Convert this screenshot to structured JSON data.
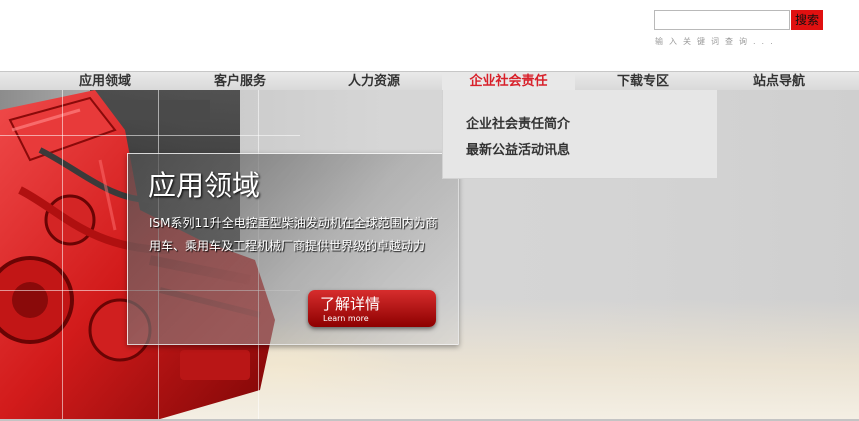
{
  "search": {
    "placeholder": "",
    "button_label": "搜索",
    "hint": "输入关键词查询..."
  },
  "nav": {
    "items": [
      {
        "label": "应用领域"
      },
      {
        "label": "客户服务"
      },
      {
        "label": "人力资源"
      },
      {
        "label": "企业社会责任",
        "active": true
      },
      {
        "label": "下载专区"
      },
      {
        "label": "站点导航"
      }
    ]
  },
  "dropdown": {
    "items": [
      {
        "label": "企业社会责任简介"
      },
      {
        "label": "最新公益活动讯息"
      }
    ]
  },
  "hero": {
    "title": "应用领域",
    "description": "ISM系列11升全电控重型柴油发动机在全球范围内为商用车、乘用车及工程机械厂商提供世界级的卓越动力",
    "button_label": "了解详情",
    "button_sub": "Learn more"
  },
  "colors": {
    "accent": "#d8202a",
    "button": "#b81818",
    "nav_bg": "#e0e0e0"
  }
}
